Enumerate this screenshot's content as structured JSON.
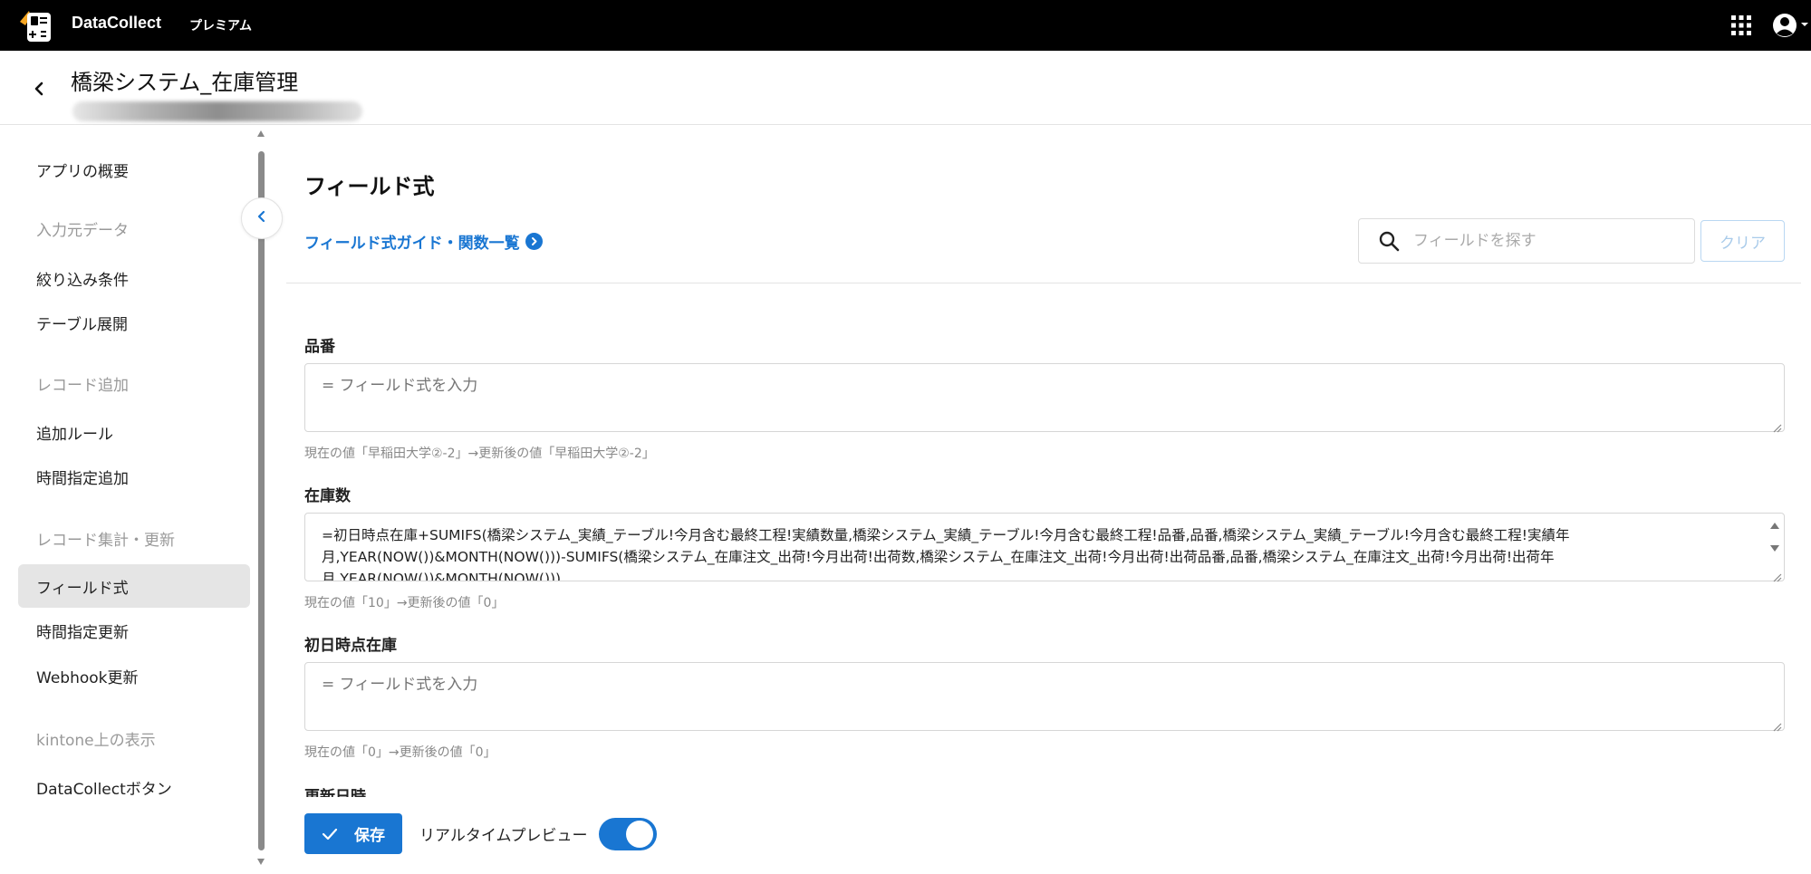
{
  "topbar": {
    "brand": "DataCollect",
    "plan": "プレミアム",
    "apps_icon": "grid-icon",
    "user_icon": "account-circle-icon"
  },
  "header": {
    "app_title": "橋梁システム_在庫管理"
  },
  "sidebar": {
    "items": [
      {
        "type": "item",
        "label": "アプリの概要"
      },
      {
        "type": "group",
        "label": "入力元データ"
      },
      {
        "type": "item",
        "label": "絞り込み条件"
      },
      {
        "type": "item",
        "label": "テーブル展開"
      },
      {
        "type": "group",
        "label": "レコード追加"
      },
      {
        "type": "item",
        "label": "追加ルール"
      },
      {
        "type": "item",
        "label": "時間指定追加"
      },
      {
        "type": "group",
        "label": "レコード集計・更新"
      },
      {
        "type": "item",
        "label": "フィールド式",
        "active": true
      },
      {
        "type": "item",
        "label": "時間指定更新"
      },
      {
        "type": "item",
        "label": "Webhook更新"
      },
      {
        "type": "group",
        "label": "kintone上の表示"
      },
      {
        "type": "item",
        "label": "DataCollectボタン"
      }
    ]
  },
  "main": {
    "title": "フィールド式",
    "guide_link": "フィールド式ガイド・関数一覧",
    "search_placeholder": "フィールドを探す",
    "clear_label": "クリア",
    "fields": [
      {
        "label": "品番",
        "value": "",
        "placeholder": "= フィールド式を入力",
        "preview": "現在の値「早稲田大学②-2」→更新後の値「早稲田大学②-2」"
      },
      {
        "label": "在庫数",
        "value": "=初日時点在庫+SUMIFS(橋梁システム_実績_テーブル!今月含む最終工程!実績数量,橋梁システム_実績_テーブル!今月含む最終工程!品番,品番,橋梁システム_実績_テーブル!今月含む最終工程!実績年月,YEAR(NOW())&MONTH(NOW()))-SUMIFS(橋梁システム_在庫注文_出荷!今月出荷!出荷数,橋梁システム_在庫注文_出荷!今月出荷!出荷品番,品番,橋梁システム_在庫注文_出荷!今月出荷!出荷年月,YEAR(NOW())&MONTH(NOW()))",
        "placeholder": "= フィールド式を入力",
        "preview": "現在の値「10」→更新後の値「0」"
      },
      {
        "label": "初日時点在庫",
        "value": "",
        "placeholder": "= フィールド式を入力",
        "preview": "現在の値「0」→更新後の値「0」"
      },
      {
        "label": "更新日時"
      }
    ]
  },
  "footer": {
    "save_label": "保存",
    "realtime_label": "リアルタイムプレビュー",
    "realtime_on": true
  },
  "colors": {
    "accent": "#1976d2",
    "topbar": "#000000",
    "active_bg": "#e5e5e5"
  }
}
